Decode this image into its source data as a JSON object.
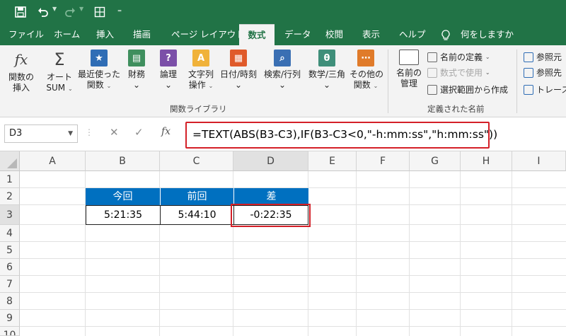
{
  "tabs": [
    "ファイル",
    "ホーム",
    "挿入",
    "描画",
    "ページ レイアウト",
    "数式",
    "データ",
    "校閲",
    "表示",
    "ヘルプ",
    "何をしますか"
  ],
  "ribbon": {
    "fx": {
      "glyph": "fx",
      "label1": "関数の",
      "label2": "挿入"
    },
    "autosum": {
      "glyph": "Σ",
      "label1": "オート",
      "label2": "SUM"
    },
    "recent": {
      "glyph": "★",
      "label1": "最近使った",
      "label2": "関数"
    },
    "finance": {
      "glyph": "▤",
      "label1": "財務"
    },
    "logic": {
      "glyph": "?",
      "label1": "論理"
    },
    "text": {
      "glyph": "A",
      "label1": "文字列",
      "label2": "操作"
    },
    "datetime": {
      "glyph": "▦",
      "label1": "日付/時刻"
    },
    "lookup": {
      "glyph": "⌕",
      "label1": "検索/行列"
    },
    "math": {
      "glyph": "θ",
      "label1": "数学/三角"
    },
    "other": {
      "glyph": "⋯",
      "label1": "その他の",
      "label2": "関数"
    },
    "group1": "関数ライブラリ",
    "name_manager": {
      "label1": "名前の",
      "label2": "管理"
    },
    "define_name": "名前の定義",
    "use_in_formula": "数式で使用",
    "create_from_selection": "選択範囲から作成",
    "group2": "定義された名前",
    "trace_precedents": "参照元",
    "trace_dependents": "参照先",
    "trace": "トレース"
  },
  "formula_bar": {
    "name_box": "D3",
    "cancel": "✕",
    "enter": "✓",
    "fx": "fx",
    "formula": "=TEXT(ABS(B3-C3),IF(B3-C3<0,\"-h:mm:ss\",\"h:mm:ss\"))"
  },
  "grid": {
    "columns": [
      "A",
      "B",
      "C",
      "D",
      "E",
      "F",
      "G",
      "H",
      "I"
    ],
    "rows": [
      "1",
      "2",
      "3",
      "4",
      "5",
      "6",
      "7",
      "8",
      "9",
      "10"
    ],
    "header_row": {
      "b": "今回",
      "c": "前回",
      "d": "差"
    },
    "data_row": {
      "b": "5:21:35",
      "c": "5:44:10",
      "d": "-0:22:35"
    }
  },
  "colors": {
    "excel_green": "#217346",
    "header_blue": "#0070c0",
    "highlight_red": "#d42028"
  }
}
